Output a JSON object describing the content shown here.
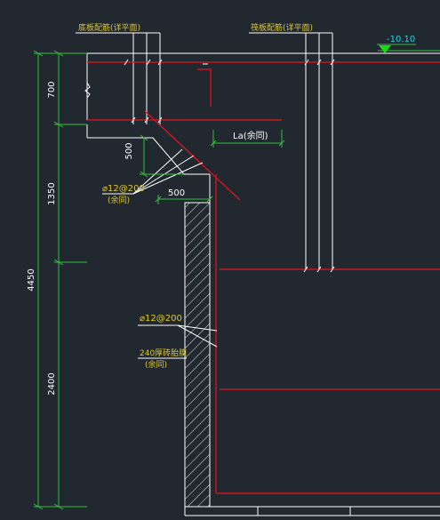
{
  "annotations": {
    "bottom_rebar_top": "底板配筋(详平面)",
    "top_rebar_top": "筏板配筋(详平面)",
    "elevation": "-10.10",
    "dim_700": "700",
    "dim_1350": "1350",
    "dim_2400": "2400",
    "dim_4450": "4450",
    "dim_500_vertical": "500",
    "dim_500_horizontal": "500",
    "la_label": "La(余同)",
    "rebar_a_line1": "⌀12@200",
    "rebar_a_line2": "(余同)",
    "rebar_b": "⌀12@200",
    "brick_line1": "240厚砖胎膜",
    "brick_line2": "(余同)"
  },
  "colors": {
    "background": "#212830",
    "outline": "#ffffff",
    "rebar": "#e8141c",
    "dimension": "#33c13a",
    "text": "#dcc832",
    "elevation_text": "#19d7e6",
    "elevation_mark": "#19d719"
  }
}
